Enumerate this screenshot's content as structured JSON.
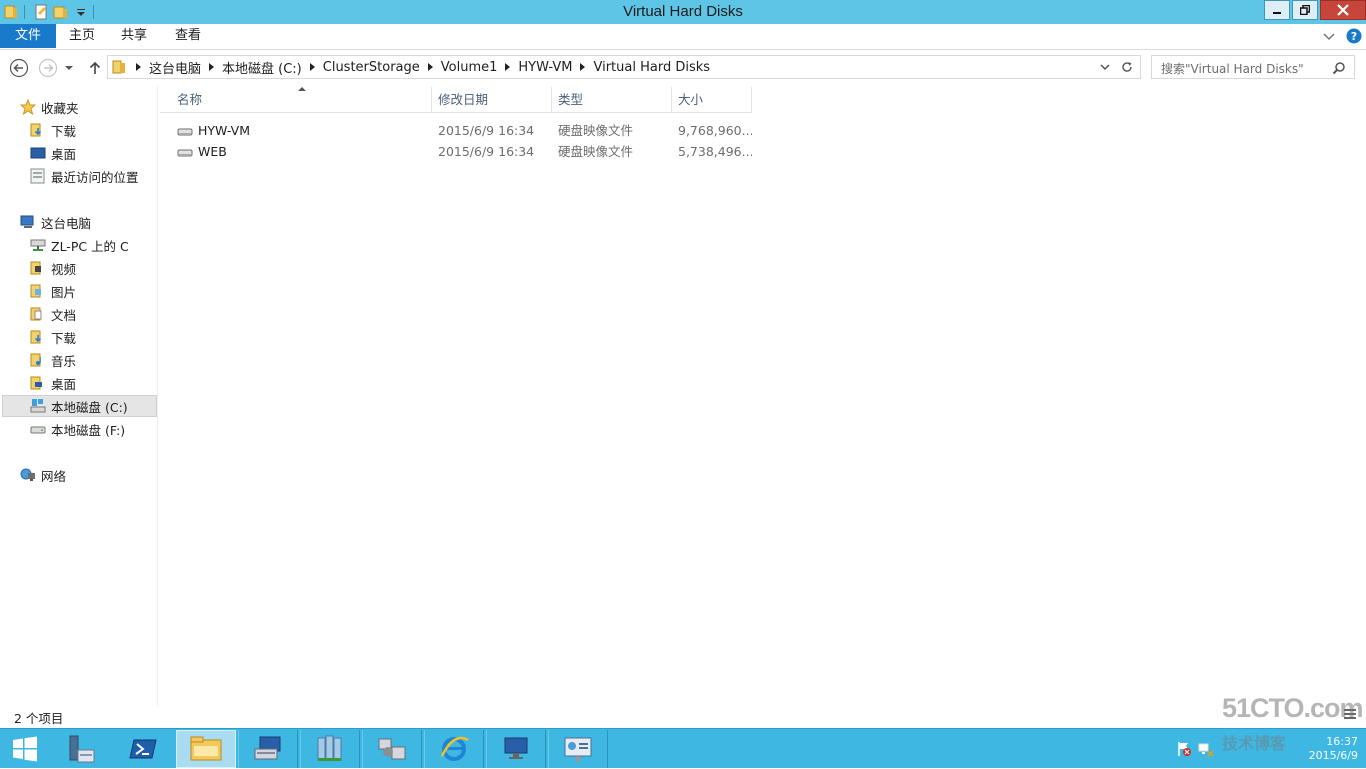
{
  "window": {
    "title": "Virtual Hard Disks"
  },
  "ribbon": {
    "tabs": [
      "文件",
      "主页",
      "共享",
      "查看"
    ]
  },
  "address": {
    "crumbs": [
      "这台电脑",
      "本地磁盘 (C:)",
      "ClusterStorage",
      "Volume1",
      "HYW-VM",
      "Virtual Hard Disks"
    ],
    "search_placeholder": "搜索\"Virtual Hard Disks\""
  },
  "navpane": {
    "favorites_label": "收藏夹",
    "favorites": [
      "下载",
      "桌面",
      "最近访问的位置"
    ],
    "thispc_label": "这台电脑",
    "thispc_items": [
      "ZL-PC 上的 C",
      "视频",
      "图片",
      "文档",
      "下载",
      "音乐",
      "桌面",
      "本地磁盘 (C:)",
      "本地磁盘 (F:)"
    ],
    "selected_item": "本地磁盘 (C:)",
    "network_label": "网络"
  },
  "filelist": {
    "columns": [
      "名称",
      "修改日期",
      "类型",
      "大小"
    ],
    "rows": [
      {
        "name": "HYW-VM",
        "modified": "2015/6/9 16:34",
        "type": "硬盘映像文件",
        "size": "9,768,960..."
      },
      {
        "name": "WEB",
        "modified": "2015/6/9 16:34",
        "type": "硬盘映像文件",
        "size": "5,738,496..."
      }
    ]
  },
  "status": {
    "item_count": "2 个项目"
  },
  "taskbar": {
    "apps": [
      "start-icon",
      "server-manager-icon",
      "powershell-icon",
      "file-explorer-icon",
      "hyperv-manager-icon",
      "cluster-icon",
      "network-settings-icon",
      "ie-icon",
      "remote-desktop-icon",
      "control-panel-icon"
    ],
    "clock_time": "16:37",
    "clock_date": "2015/6/9"
  },
  "watermark": {
    "line1": "51CTO.com",
    "line2": "技术博客"
  },
  "colors": {
    "titlebar": "#5ec5e6",
    "file_tab": "#1979ca",
    "taskbar": "#3eb7e2"
  }
}
